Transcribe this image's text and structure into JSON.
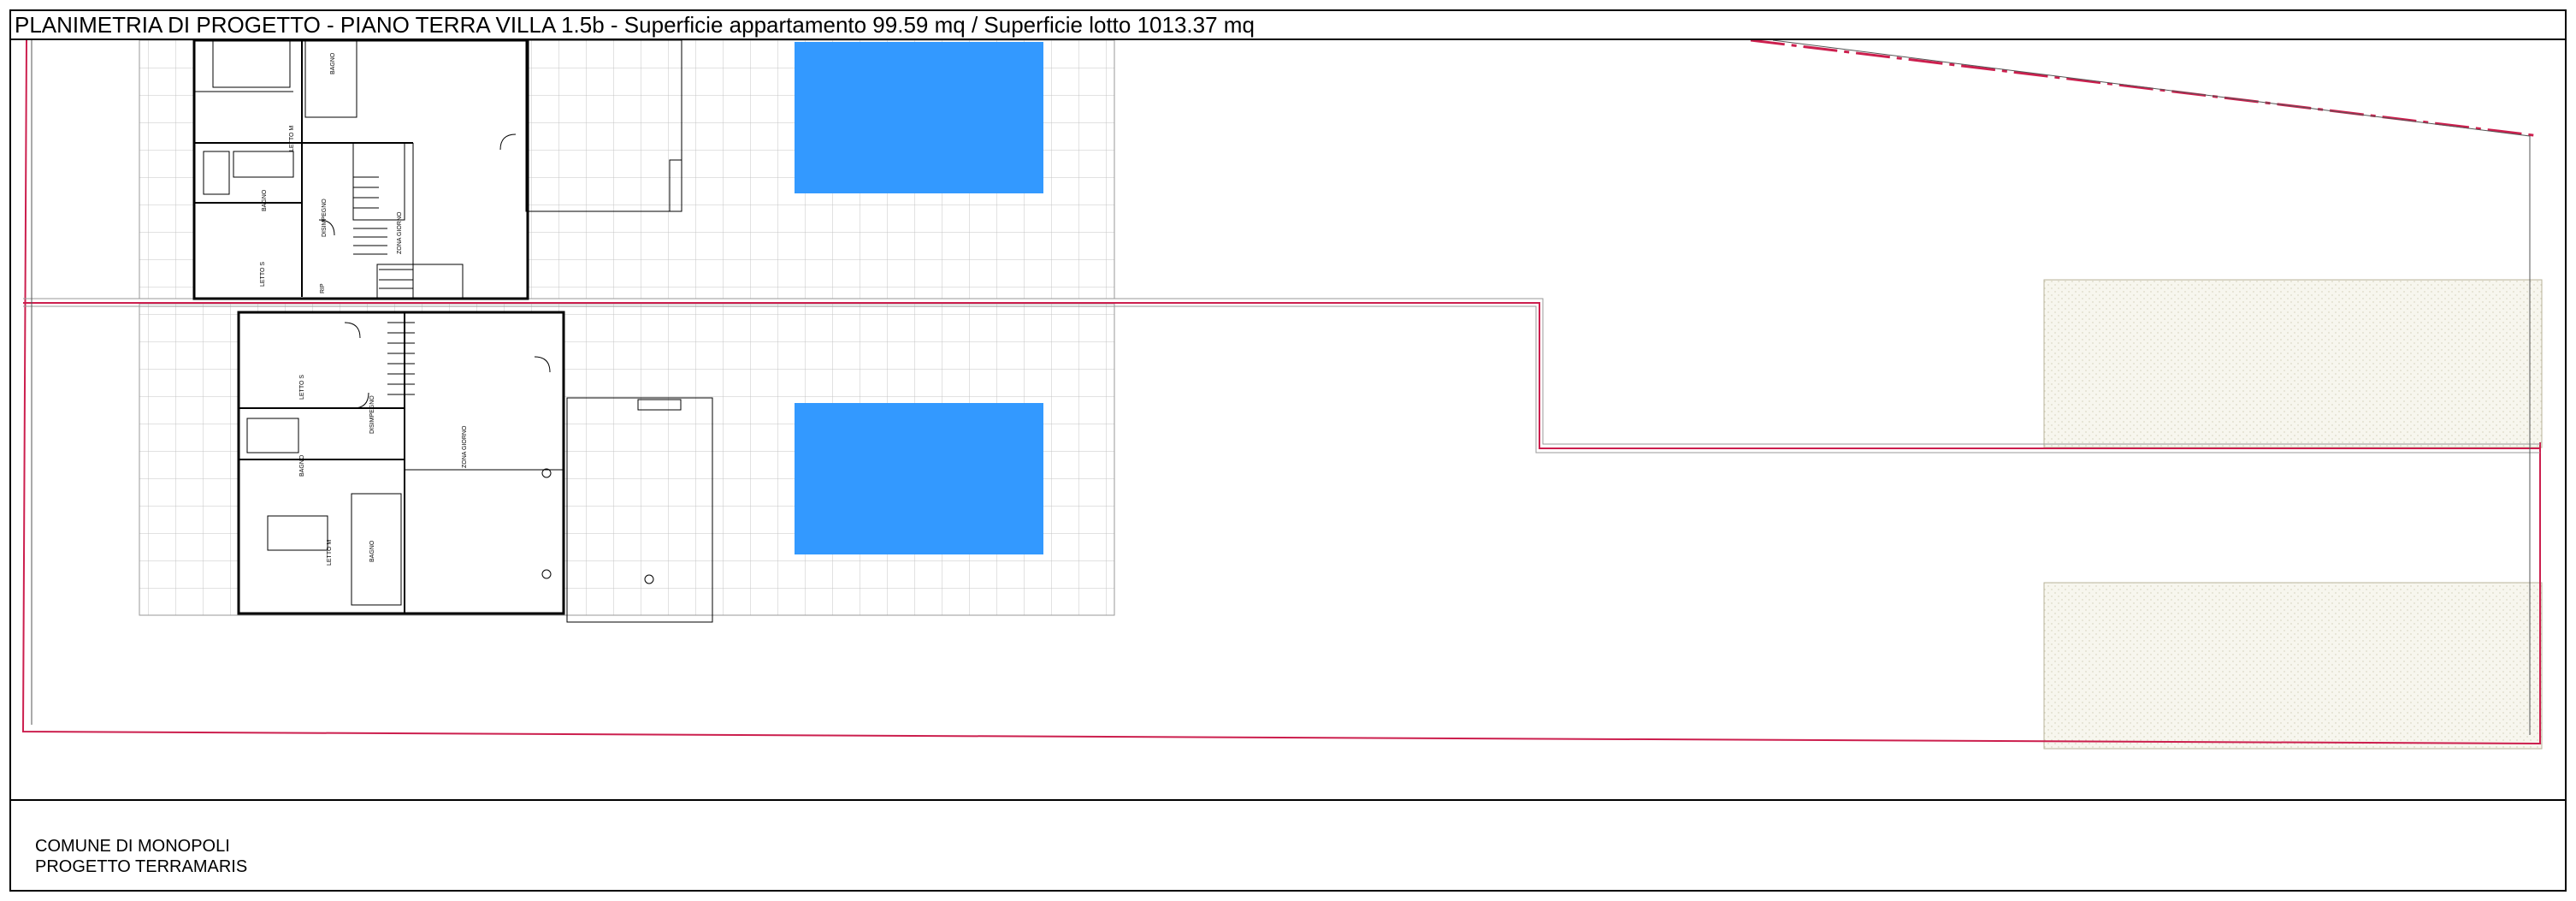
{
  "header": {
    "title": "PLANIMETRIA DI PROGETTO - PIANO TERRA VILLA 1.5b - Superficie appartamento 99.59 mq / Superficie lotto 1013.37 mq"
  },
  "footer": {
    "line1": "COMUNE DI MONOPOLI",
    "line2": "PROGETTO TERRAMARIS"
  },
  "rooms": {
    "upper": {
      "letto_m": "LETTO M",
      "bagno_a": "BAGNO",
      "bagno_b": "BAGNO",
      "disimpegno": "DISIMPEGNO",
      "letto_s": "LETTO S",
      "rip": "RIP",
      "zona_giorno": "ZONA GIORNO"
    },
    "lower": {
      "letto_s": "LETTO S",
      "disimpegno": "DISIMPEGNO",
      "bagno_a": "BAGNO",
      "zona_giorno": "ZONA GIORNO",
      "bagno_b": "BAGNO",
      "letto_m": "LETTO M"
    }
  },
  "colors": {
    "pool": "#3399ff",
    "boundary": "#cc1f4e",
    "paving_line": "#b9b9b9",
    "garden_fill": "#f6f5ec",
    "wall": "#000000"
  }
}
